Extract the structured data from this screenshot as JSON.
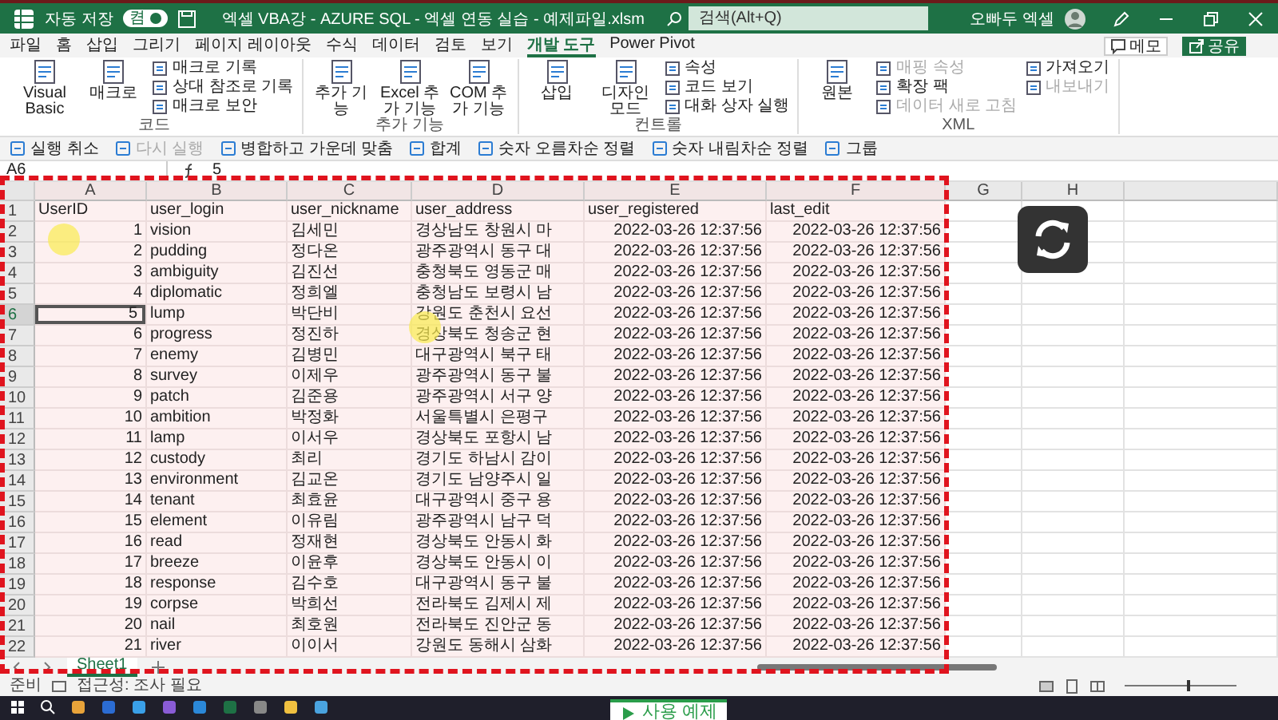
{
  "window": {
    "autosave_label": "자동 저장",
    "autosave": {
      "on": true,
      "text": "켬"
    },
    "title": "엑셀 VBA강 - AZURE SQL - 엑셀 연동 실습 - 예제파일.xlsm",
    "search_placeholder": "검색(Alt+Q)",
    "user": "오빠두 엑셀"
  },
  "ribbon_tabs": [
    {
      "label": "파일",
      "selected": false
    },
    {
      "label": "홈",
      "selected": false
    },
    {
      "label": "삽입",
      "selected": false
    },
    {
      "label": "그리기",
      "selected": false
    },
    {
      "label": "페이지 레이아웃",
      "selected": false
    },
    {
      "label": "수식",
      "selected": false
    },
    {
      "label": "데이터",
      "selected": false
    },
    {
      "label": "검토",
      "selected": false
    },
    {
      "label": "보기",
      "selected": false
    },
    {
      "label": "개발 도구",
      "selected": true
    },
    {
      "label": "Power Pivot",
      "selected": false
    }
  ],
  "ribbon_actions": {
    "comment": "메모",
    "share": "공유"
  },
  "ribbon_groups": [
    {
      "name": "코드",
      "items": [
        {
          "kind": "large",
          "label": "Visual Basic",
          "disabled": false
        },
        {
          "kind": "large",
          "label": "매크로",
          "disabled": false
        },
        {
          "kind": "small",
          "label": "매크로 기록",
          "disabled": false
        },
        {
          "kind": "small",
          "label": "상대 참조로 기록",
          "disabled": false
        },
        {
          "kind": "small",
          "label": "매크로 보안",
          "disabled": false
        }
      ]
    },
    {
      "name": "추가 기능",
      "items": [
        {
          "kind": "large",
          "label": "추가 기능",
          "disabled": false
        },
        {
          "kind": "large",
          "label": "Excel 추가 기능",
          "disabled": false
        },
        {
          "kind": "large",
          "label": "COM 추가 기능",
          "disabled": false
        }
      ]
    },
    {
      "name": "컨트롤",
      "items": [
        {
          "kind": "large",
          "label": "삽입",
          "disabled": false
        },
        {
          "kind": "large",
          "label": "디자인 모드",
          "disabled": false
        },
        {
          "kind": "small",
          "label": "속성",
          "disabled": false
        },
        {
          "kind": "small",
          "label": "코드 보기",
          "disabled": false
        },
        {
          "kind": "small",
          "label": "대화 상자 실행",
          "disabled": false
        }
      ]
    },
    {
      "name": "XML",
      "items": [
        {
          "kind": "large",
          "label": "원본",
          "disabled": false
        },
        {
          "kind": "small",
          "label": "매핑 속성",
          "disabled": true
        },
        {
          "kind": "small",
          "label": "확장 팩",
          "disabled": false
        },
        {
          "kind": "small",
          "label": "데이터 새로 고침",
          "disabled": true
        },
        {
          "kind": "small",
          "label": "가져오기",
          "disabled": false
        },
        {
          "kind": "small",
          "label": "내보내기",
          "disabled": true
        }
      ]
    }
  ],
  "quick_access": [
    {
      "label": "실행 취소",
      "disabled": false
    },
    {
      "label": "다시 실행",
      "disabled": true
    },
    {
      "label": "병합하고 가운데 맞춤",
      "disabled": false
    },
    {
      "label": "합계",
      "disabled": false
    },
    {
      "label": "숫자 오름차순 정렬",
      "disabled": false
    },
    {
      "label": "숫자 내림차순 정렬",
      "disabled": false
    },
    {
      "label": "그룹",
      "disabled": false
    }
  ],
  "formula_bar": {
    "name_box": "A6",
    "formula": "5"
  },
  "sheet": {
    "columns": [
      "A",
      "B",
      "C",
      "D",
      "E",
      "F",
      "G",
      "H"
    ],
    "rows": [
      {
        "number": "1",
        "kind": "header",
        "selected": false,
        "cells": [
          "UserID",
          "user_login",
          "user_nickname",
          "user_address",
          "user_registered",
          "last_edit"
        ]
      },
      {
        "number": "2",
        "kind": "data",
        "selected": false,
        "cells": [
          "1",
          "vision",
          "김세민",
          "경상남도 창원시 마",
          "2022-03-26 12:37:56",
          "2022-03-26 12:37:56"
        ]
      },
      {
        "number": "3",
        "kind": "data",
        "selected": false,
        "cells": [
          "2",
          "pudding",
          "정다온",
          "광주광역시 동구 대",
          "2022-03-26 12:37:56",
          "2022-03-26 12:37:56"
        ]
      },
      {
        "number": "4",
        "kind": "data",
        "selected": false,
        "cells": [
          "3",
          "ambiguity",
          "김진선",
          "충청북도 영동군 매",
          "2022-03-26 12:37:56",
          "2022-03-26 12:37:56"
        ]
      },
      {
        "number": "5",
        "kind": "data",
        "selected": false,
        "cells": [
          "4",
          "diplomatic",
          "정희엘",
          "충청남도 보령시 남",
          "2022-03-26 12:37:56",
          "2022-03-26 12:37:56"
        ]
      },
      {
        "number": "6",
        "kind": "data",
        "selected": true,
        "cells": [
          "5",
          "lump",
          "박단비",
          "강원도 춘천시 요선",
          "2022-03-26 12:37:56",
          "2022-03-26 12:37:56"
        ]
      },
      {
        "number": "7",
        "kind": "data",
        "selected": false,
        "cells": [
          "6",
          "progress",
          "정진하",
          "경상북도 청송군 현",
          "2022-03-26 12:37:56",
          "2022-03-26 12:37:56"
        ]
      },
      {
        "number": "8",
        "kind": "data",
        "selected": false,
        "cells": [
          "7",
          "enemy",
          "김병민",
          "대구광역시 북구 태",
          "2022-03-26 12:37:56",
          "2022-03-26 12:37:56"
        ]
      },
      {
        "number": "9",
        "kind": "data",
        "selected": false,
        "cells": [
          "8",
          "survey",
          "이제우",
          "광주광역시 동구 불",
          "2022-03-26 12:37:56",
          "2022-03-26 12:37:56"
        ]
      },
      {
        "number": "10",
        "kind": "data",
        "selected": false,
        "cells": [
          "9",
          "patch",
          "김준용",
          "광주광역시 서구 양",
          "2022-03-26 12:37:56",
          "2022-03-26 12:37:56"
        ]
      },
      {
        "number": "11",
        "kind": "data",
        "selected": false,
        "cells": [
          "10",
          "ambition",
          "박정화",
          "서울특별시 은평구",
          "2022-03-26 12:37:56",
          "2022-03-26 12:37:56"
        ]
      },
      {
        "number": "12",
        "kind": "data",
        "selected": false,
        "cells": [
          "11",
          "lamp",
          "이서우",
          "경상북도 포항시 남",
          "2022-03-26 12:37:56",
          "2022-03-26 12:37:56"
        ]
      },
      {
        "number": "13",
        "kind": "data",
        "selected": false,
        "cells": [
          "12",
          "custody",
          "최리",
          "경기도 하남시 감이",
          "2022-03-26 12:37:56",
          "2022-03-26 12:37:56"
        ]
      },
      {
        "number": "14",
        "kind": "data",
        "selected": false,
        "cells": [
          "13",
          "environment",
          "김교온",
          "경기도 남양주시 일",
          "2022-03-26 12:37:56",
          "2022-03-26 12:37:56"
        ]
      },
      {
        "number": "15",
        "kind": "data",
        "selected": false,
        "cells": [
          "14",
          "tenant",
          "최효윤",
          "대구광역시 중구 용",
          "2022-03-26 12:37:56",
          "2022-03-26 12:37:56"
        ]
      },
      {
        "number": "16",
        "kind": "data",
        "selected": false,
        "cells": [
          "15",
          "element",
          "이유림",
          "광주광역시 남구 덕",
          "2022-03-26 12:37:56",
          "2022-03-26 12:37:56"
        ]
      },
      {
        "number": "17",
        "kind": "data",
        "selected": false,
        "cells": [
          "16",
          "read",
          "정재현",
          "경상북도 안동시 화",
          "2022-03-26 12:37:56",
          "2022-03-26 12:37:56"
        ]
      },
      {
        "number": "18",
        "kind": "data",
        "selected": false,
        "cells": [
          "17",
          "breeze",
          "이윤후",
          "경상북도 안동시 이",
          "2022-03-26 12:37:56",
          "2022-03-26 12:37:56"
        ]
      },
      {
        "number": "19",
        "kind": "data",
        "selected": false,
        "cells": [
          "18",
          "response",
          "김수호",
          "대구광역시 동구 불",
          "2022-03-26 12:37:56",
          "2022-03-26 12:37:56"
        ]
      },
      {
        "number": "20",
        "kind": "data",
        "selected": false,
        "cells": [
          "19",
          "corpse",
          "박희선",
          "전라북도 김제시 제",
          "2022-03-26 12:37:56",
          "2022-03-26 12:37:56"
        ]
      },
      {
        "number": "21",
        "kind": "data",
        "selected": false,
        "cells": [
          "20",
          "nail",
          "최호원",
          "전라북도 진안군 동",
          "2022-03-26 12:37:56",
          "2022-03-26 12:37:56"
        ]
      },
      {
        "number": "22",
        "kind": "data",
        "selected": false,
        "cells": [
          "21",
          "river",
          "이이서",
          "강원도 동해시 삼화",
          "2022-03-26 12:37:56",
          "2022-03-26 12:37:56"
        ]
      }
    ]
  },
  "sheet_tabs": [
    {
      "label": "Sheet1",
      "selected": true
    }
  ],
  "status_bar": {
    "ready": "준비",
    "accessibility": "접근성: 조사 필요",
    "zoom": {
      "level": 0.55
    }
  },
  "popup": {
    "label": "사용 예제"
  }
}
